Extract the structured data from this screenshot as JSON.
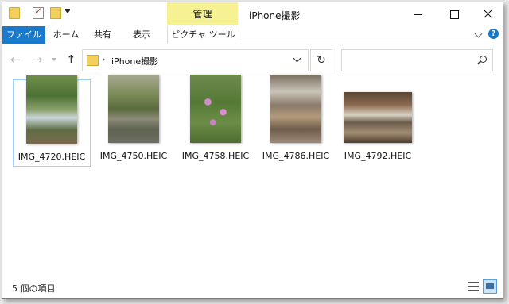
{
  "window": {
    "title": "iPhone撮影"
  },
  "ribbon": {
    "contextual_group": "管理",
    "tabs": [
      "ファイル",
      "ホーム",
      "共有",
      "表示",
      "ピクチャ ツール"
    ]
  },
  "address": {
    "path": "iPhone撮影",
    "separator": "›"
  },
  "files": [
    {
      "name": "IMG_4720.HEIC",
      "selected": true
    },
    {
      "name": "IMG_4750.HEIC",
      "selected": false
    },
    {
      "name": "IMG_4758.HEIC",
      "selected": false
    },
    {
      "name": "IMG_4786.HEIC",
      "selected": false
    },
    {
      "name": "IMG_4792.HEIC",
      "selected": false
    }
  ],
  "status": {
    "item_count": "5 個の項目"
  },
  "colors": {
    "file_tab": "#1979ca",
    "manage_tab": "#f6f193",
    "selection_border": "#99d1ff"
  }
}
